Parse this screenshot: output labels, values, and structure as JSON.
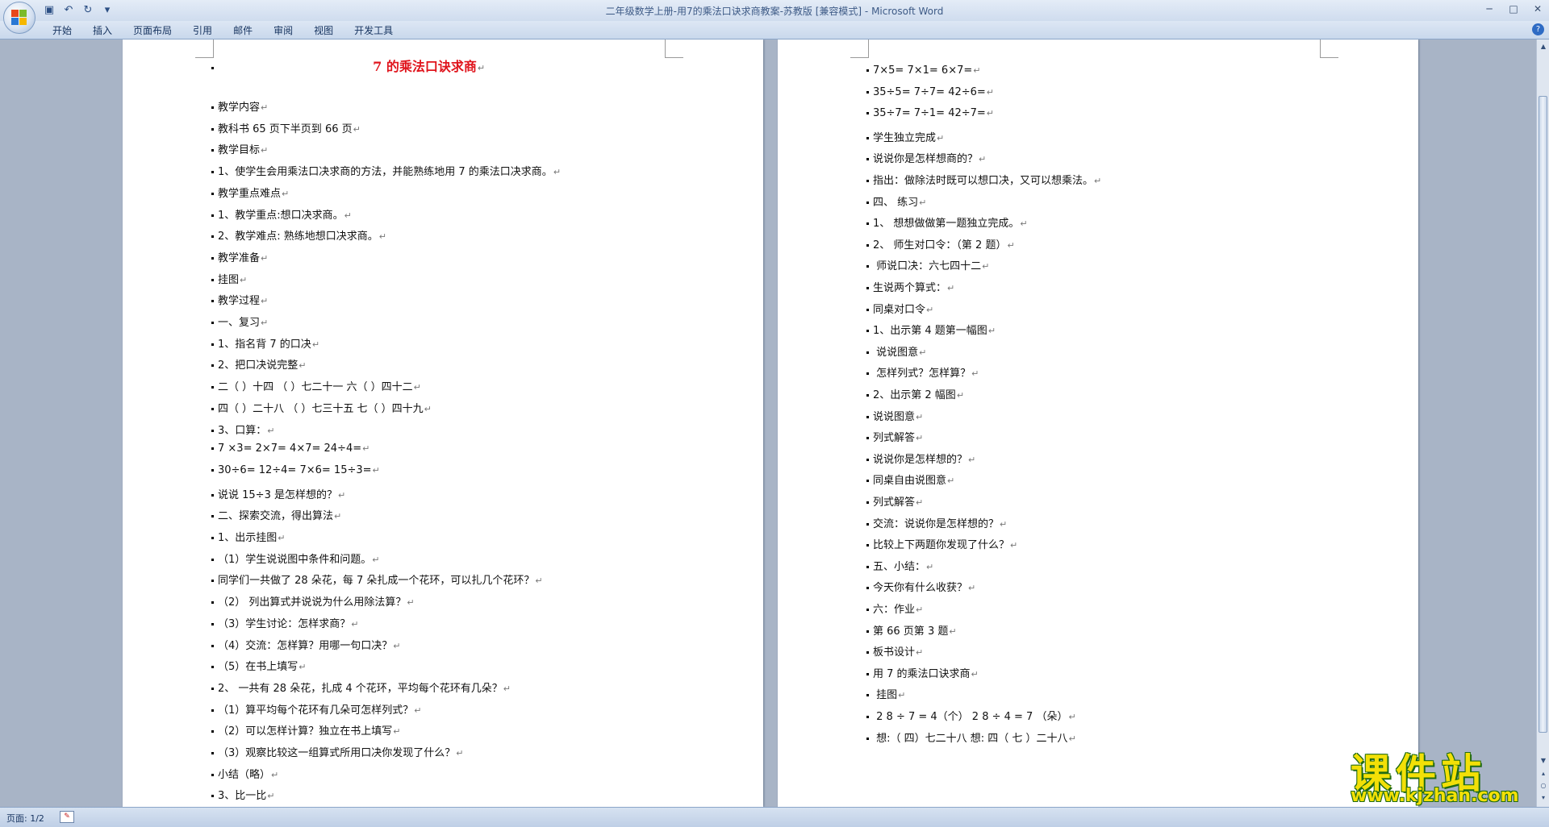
{
  "window": {
    "title": "二年级数学上册-用7的乘法口诀求商教案-苏教版 [兼容模式] - Microsoft Word",
    "qat_icons": [
      "save-icon",
      "undo-icon",
      "redo-icon",
      "customize-icon"
    ],
    "qat_glyphs": [
      "▣",
      "↶",
      "↻",
      "▾"
    ],
    "controls": [
      "─",
      "□",
      "✕"
    ],
    "help": "?"
  },
  "ribbon": {
    "tabs": [
      "开始",
      "插入",
      "页面布局",
      "引用",
      "邮件",
      "审阅",
      "视图",
      "开发工具"
    ]
  },
  "document": {
    "para_mark": "↵",
    "page1": {
      "title": "7 的乘法口诀求商",
      "lines": [
        "教学内容",
        "教科书 65 页下半页到 66 页",
        "教学目标",
        "1、使学生会用乘法口决求商的方法，并能熟练地用 7 的乘法口决求商。",
        "教学重点难点",
        "1、教学重点:想口决求商。",
        "2、教学难点: 熟练地想口决求商。",
        "教学准备",
        "挂图",
        "教学过程",
        "一、复习",
        "1、指名背 7 的口决",
        "2、把口决说完整",
        "二（    ）十四    （      ）七二十一      六（    ）四十二",
        "四（    ）二十八  （      ）七三十五      七（    ）四十九",
        "3、口算：",
        "7 ×3=    2×7=      4×7=          24÷4=",
        "30÷6=    12÷4=    7×6=          15÷3=",
        "说说 15÷3 是怎样想的？",
        "二、探索交流，得出算法",
        "1、出示挂图",
        "（1）学生说说图中条件和问题。",
        "同学们一共做了 28 朵花，每 7 朵扎成一个花环，可以扎几个花环？",
        "（2）  列出算式并说说为什么用除法算？",
        "（3）学生讨论：怎样求商？",
        "（4）交流：怎样算？用哪一句口决？",
        "（5）在书上填写",
        "2、  一共有 28 朵花，扎成 4 个花环，平均每个花环有几朵？",
        "（1）算平均每个花环有几朵可怎样列式？",
        "（2）可以怎样计算？独立在书上填写",
        "（3）观察比较这一组算式所用口决你发现了什么？",
        "小结（略）",
        "3、比一比"
      ]
    },
    "page2": {
      "lines": [
        "7×5=           7×1=            6×7=",
        "35÷5=          7÷7=            42÷6=",
        "35÷7=          7÷1=            42÷7=",
        "学生独立完成",
        "说说你是怎样想商的？",
        "指出：做除法时既可以想口决，又可以想乘法。",
        "四、        练习",
        "1、  想想做做第一题独立完成。",
        "2、  师生对口令：（第 2 题）",
        "   师说口决：六七四十二",
        "生说两个算式：",
        "同桌对口令",
        "1、出示第 4 题第一幅图",
        "     说说图意",
        "     怎样列式？怎样算？",
        "2、出示第 2 幅图",
        "说说图意",
        "列式解答",
        "说说你是怎样想的？",
        "同桌自由说图意",
        "列式解答",
        "交流：说说你是怎样想的？",
        "比较上下两题你发现了什么？",
        "五、小结：",
        "今天你有什么收获？",
        "六：作业",
        "第 66 页第 3 题",
        "板书设计",
        "用 7 的乘法口诀求商",
        "                          挂图",
        "             2 8  ÷  7 = 4（个）            2 8  ÷  4 = 7 （朵）",
        "       想:（ 四）七二十八          想:  四（ 七 ）二十八"
      ]
    }
  },
  "scrollbar": {
    "arrows": [
      "▲",
      "▼"
    ],
    "nav": [
      "▴",
      "○",
      "▾"
    ]
  },
  "statusbar": {
    "page_count": "页面: 1/2",
    "proof_glyph": "✎"
  },
  "watermark": {
    "title": "课件站",
    "url": "www.kjzhan.com"
  }
}
